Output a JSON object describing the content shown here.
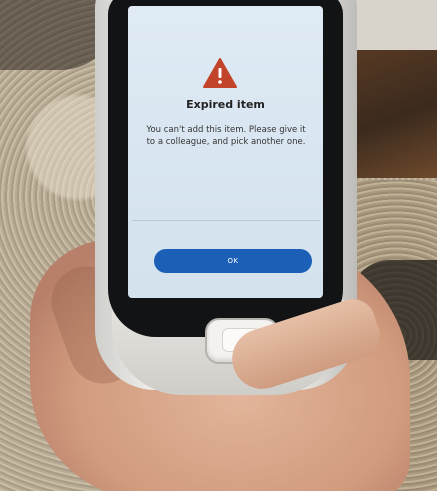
{
  "dialog": {
    "title": "Expired item",
    "message": "You can't add this item. Please give it to a colleague, and pick another one.",
    "ok_label": "OK",
    "warning_icon": "warning-triangle-icon",
    "accent_color": "#1b5fb6",
    "warning_color": "#c2442a"
  }
}
